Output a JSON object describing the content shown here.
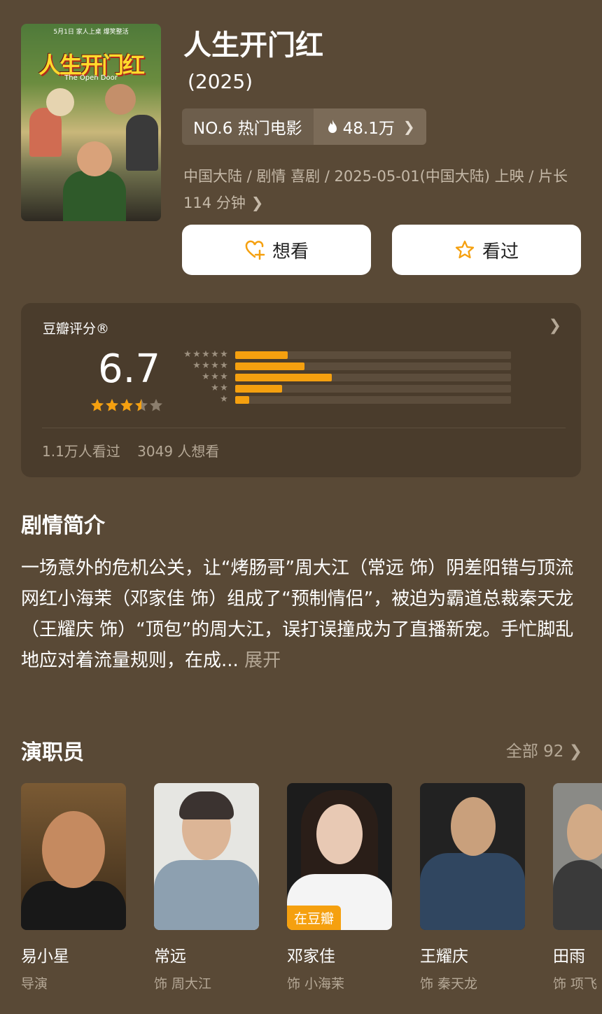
{
  "movie": {
    "poster_top_text": "5月1日 家人上桌 爆笑整活",
    "poster_title": "人生开门红",
    "poster_subtitle": "The Open Door",
    "title": "人生开门红",
    "year": "(2025)",
    "rank": "NO.6 热门电影",
    "heat": "48.1万",
    "meta": "中国大陆 / 剧情 喜剧 / 2025-05-01(中国大陆) 上映 / 片长 114 分钟",
    "want_label": "想看",
    "seen_label": "看过"
  },
  "rating": {
    "label": "豆瓣评分®",
    "score": "6.7",
    "stars": 3.5,
    "distribution": [
      {
        "stars": 5,
        "fraction": 0.19
      },
      {
        "stars": 4,
        "fraction": 0.25
      },
      {
        "stars": 3,
        "fraction": 0.35
      },
      {
        "stars": 2,
        "fraction": 0.17
      },
      {
        "stars": 1,
        "fraction": 0.05
      }
    ],
    "watched": "1.1万人看过",
    "want": "3049 人想看"
  },
  "synopsis": {
    "title": "剧情简介",
    "text": "一场意外的危机公关，让“烤肠哥”周大江（常远 饰）阴差阳错与顶流网红小海茉（邓家佳 饰）组成了“预制情侣”，被迫为霸道总裁秦天龙（王耀庆 饰）“顶包”的周大江，误打误撞成为了直播新宠。手忙脚乱地应对着流量规则，在成...",
    "more": "展开"
  },
  "cast": {
    "title": "演职员",
    "all": "全部 92",
    "members": [
      {
        "name": "易小星",
        "role": "导演",
        "badge": ""
      },
      {
        "name": "常远",
        "role": "饰 周大江",
        "badge": ""
      },
      {
        "name": "邓家佳",
        "role": "饰 小海茉",
        "badge": "在豆瓣"
      },
      {
        "name": "王耀庆",
        "role": "饰 秦天龙",
        "badge": ""
      },
      {
        "name": "田雨",
        "role": "饰 项飞",
        "badge": ""
      }
    ]
  },
  "colors": {
    "background": "#594936",
    "card": "#4a3c2c",
    "accent": "#f5a00f"
  }
}
